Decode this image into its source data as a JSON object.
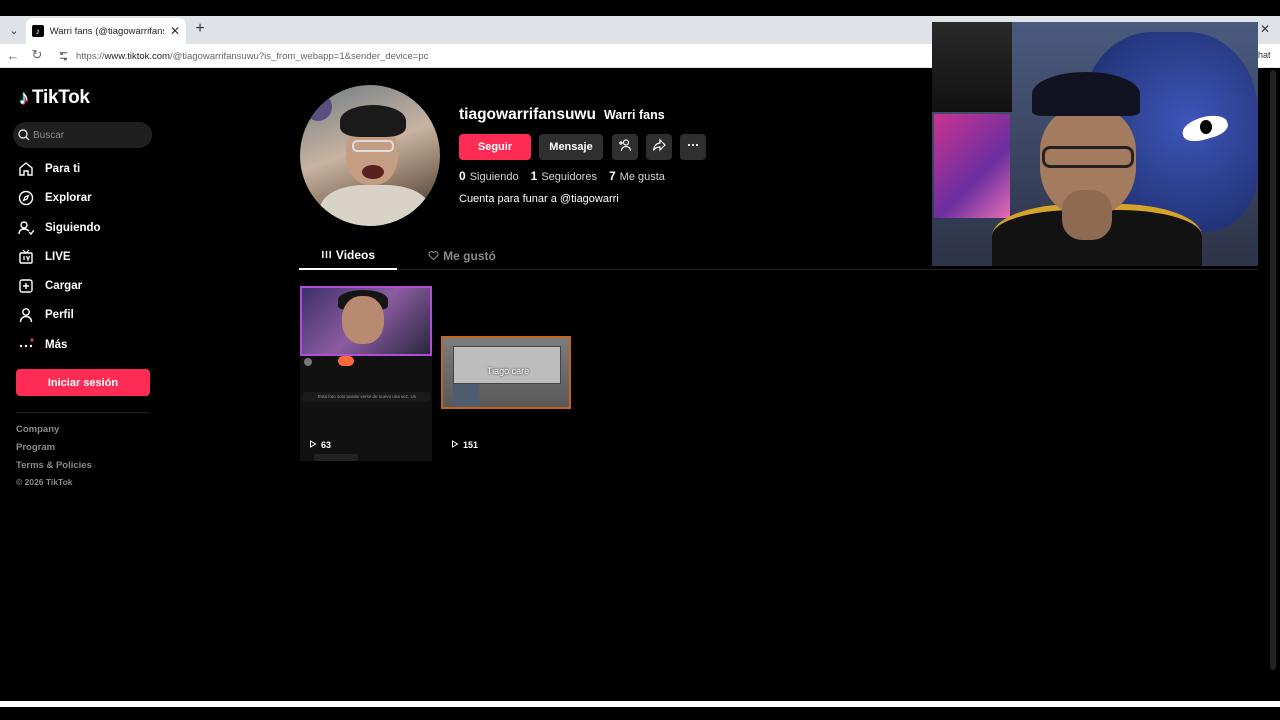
{
  "browser": {
    "tab_title": "Warri fans (@tiagowarrifansuwu) |",
    "tab_favicon": "tiktok-icon",
    "url_prefix": "https://",
    "url_host": "www.tiktok.com",
    "url_path": "/@tiagowarrifansuwu?is_from_webapp=1&sender_device=pc",
    "toolbar_right": "hat"
  },
  "sidebar": {
    "brand": "TikTok",
    "search_placeholder": "Buscar",
    "items": [
      {
        "label": "Para ti",
        "icon": "home-icon"
      },
      {
        "label": "Explorar",
        "icon": "compass-icon"
      },
      {
        "label": "Siguiendo",
        "icon": "following-icon"
      },
      {
        "label": "LIVE",
        "icon": "live-icon"
      },
      {
        "label": "Cargar",
        "icon": "upload-icon"
      },
      {
        "label": "Perfil",
        "icon": "profile-icon"
      },
      {
        "label": "Más",
        "icon": "more-icon"
      }
    ],
    "login_label": "Iniciar sesión",
    "footer_links": [
      "Company",
      "Program",
      "Terms & Policies"
    ],
    "copyright": "© 2026 TikTok"
  },
  "profile": {
    "username": "tiagowarrifansuwu",
    "nickname": "Warri fans",
    "follow_label": "Seguir",
    "message_label": "Mensaje",
    "stats": {
      "following_count": "0",
      "following_label": "Siguiendo",
      "followers_count": "1",
      "followers_label": "Seguidores",
      "likes_count": "7",
      "likes_label": "Me gusta"
    },
    "bio": "Cuenta para funar a @tiagowarri"
  },
  "tabs": {
    "videos_label": "Videos",
    "liked_label": "Me gustó"
  },
  "videos": [
    {
      "views": "63",
      "subtitle_text": "Esta foto solo puede verse de nuevo una vez. Un"
    },
    {
      "views": "151",
      "caption": "Tiago care"
    }
  ],
  "colors": {
    "accent": "#fe2c55",
    "background": "#000000",
    "button_secondary": "#2f2f2f"
  }
}
